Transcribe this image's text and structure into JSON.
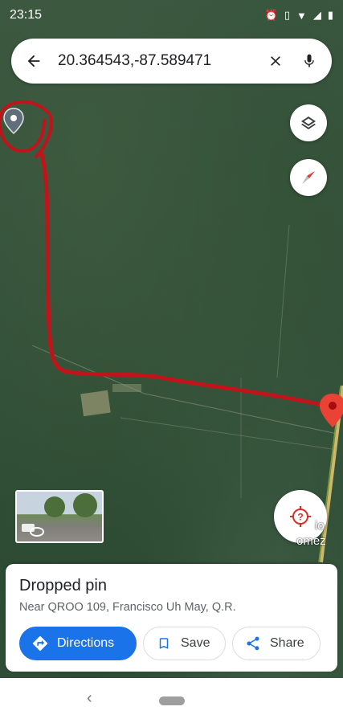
{
  "status_bar": {
    "time": "23:15",
    "icons": [
      "alarm-icon",
      "vibrate-icon",
      "wifi-icon",
      "signal-icon",
      "battery-icon"
    ]
  },
  "search": {
    "query": "20.364543,-87.589471"
  },
  "map": {
    "place_label_line1": "io",
    "place_label_line2": "omez",
    "annotation_color": "#c0141a"
  },
  "place_sheet": {
    "title": "Dropped pin",
    "subtitle": "Near QROO 109, Francisco Uh May, Q.R.",
    "actions": [
      {
        "label": "Directions",
        "icon": "directions-icon"
      },
      {
        "label": "Save",
        "icon": "bookmark-icon"
      },
      {
        "label": "Share",
        "icon": "share-icon"
      }
    ]
  },
  "colors": {
    "accent": "#1a73e8",
    "pin": "#ea4335",
    "annotation": "#c0141a"
  }
}
